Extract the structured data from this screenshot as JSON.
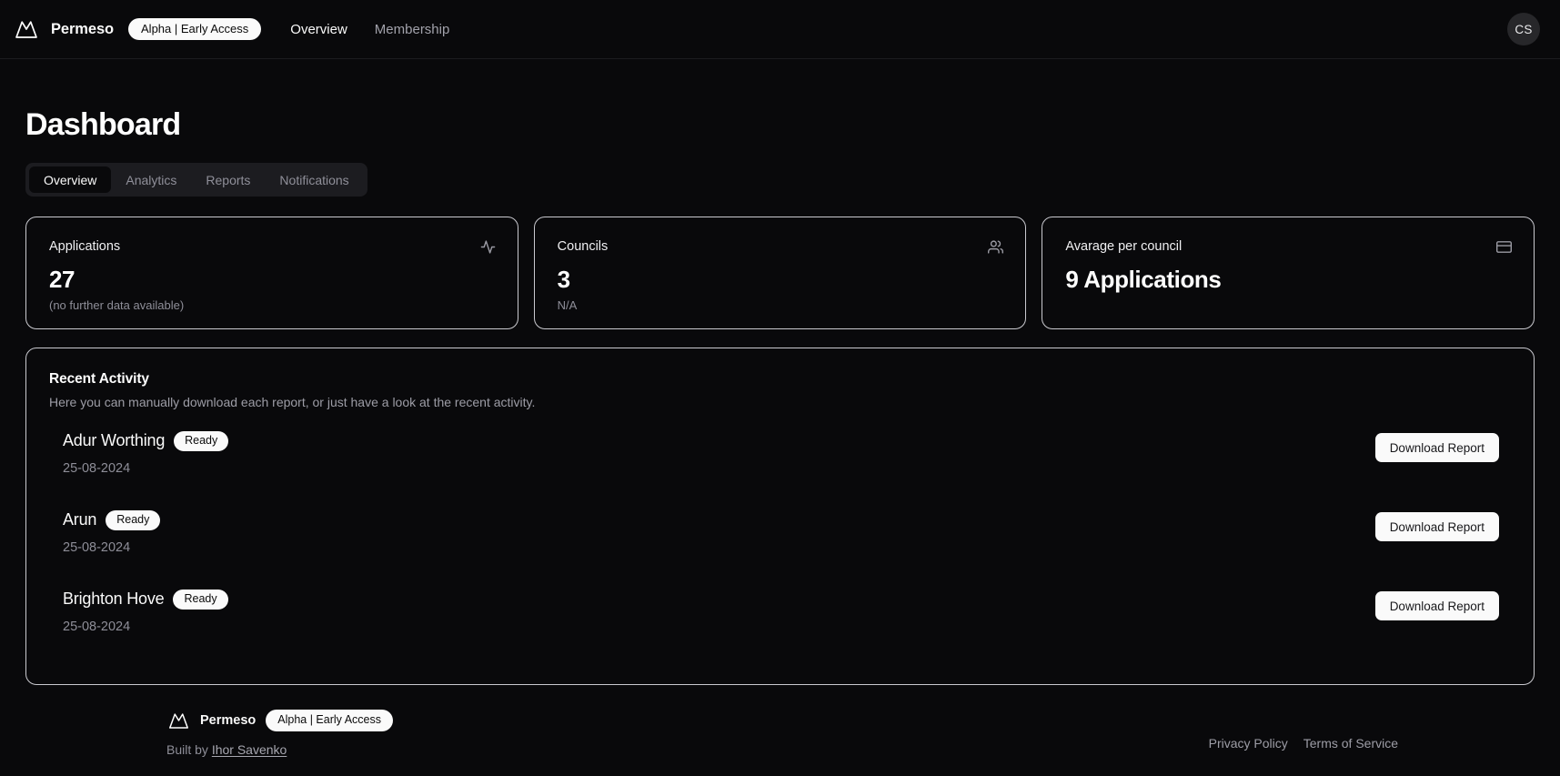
{
  "nav": {
    "logo_icon": "mountain-logo-icon",
    "brand": "Permeso",
    "badge": "Alpha | Early Access",
    "links": [
      {
        "label": "Overview",
        "active": true
      },
      {
        "label": "Membership",
        "active": false
      }
    ],
    "avatar_initials": "CS"
  },
  "page": {
    "title": "Dashboard"
  },
  "tabs": [
    {
      "label": "Overview",
      "active": true
    },
    {
      "label": "Analytics",
      "active": false
    },
    {
      "label": "Reports",
      "active": false
    },
    {
      "label": "Notifications",
      "active": false
    }
  ],
  "stat_cards": [
    {
      "label": "Applications",
      "value": "27",
      "sub": "(no further data available)",
      "icon": "activity-pulse-icon"
    },
    {
      "label": "Councils",
      "value": "3",
      "sub": "N/A",
      "icon": "users-icon"
    },
    {
      "label": "Avarage per council",
      "value": "9 Applications",
      "sub": "",
      "icon": "credit-card-icon"
    }
  ],
  "activity": {
    "title": "Recent Activity",
    "description": "Here you can manually download each report, or just have a look at the recent activity.",
    "rows": [
      {
        "name": "Adur Worthing",
        "status": "Ready",
        "date": "25-08-2024",
        "action": "Download Report"
      },
      {
        "name": "Arun",
        "status": "Ready",
        "date": "25-08-2024",
        "action": "Download Report"
      },
      {
        "name": "Brighton Hove",
        "status": "Ready",
        "date": "25-08-2024",
        "action": "Download Report"
      }
    ]
  },
  "footer": {
    "logo_icon": "mountain-logo-icon",
    "brand": "Permeso",
    "badge": "Alpha | Early Access",
    "built_by_prefix": "Built by ",
    "built_by_name": "Ihor Savenko",
    "links": [
      {
        "label": "Privacy Policy"
      },
      {
        "label": "Terms of Service"
      }
    ]
  },
  "colors": {
    "background": "#09090b",
    "card_border": "#c9c9cf",
    "accent_light": "#fafafa",
    "muted_text": "#8e8e98",
    "tabs_bg": "#1c1c20"
  }
}
